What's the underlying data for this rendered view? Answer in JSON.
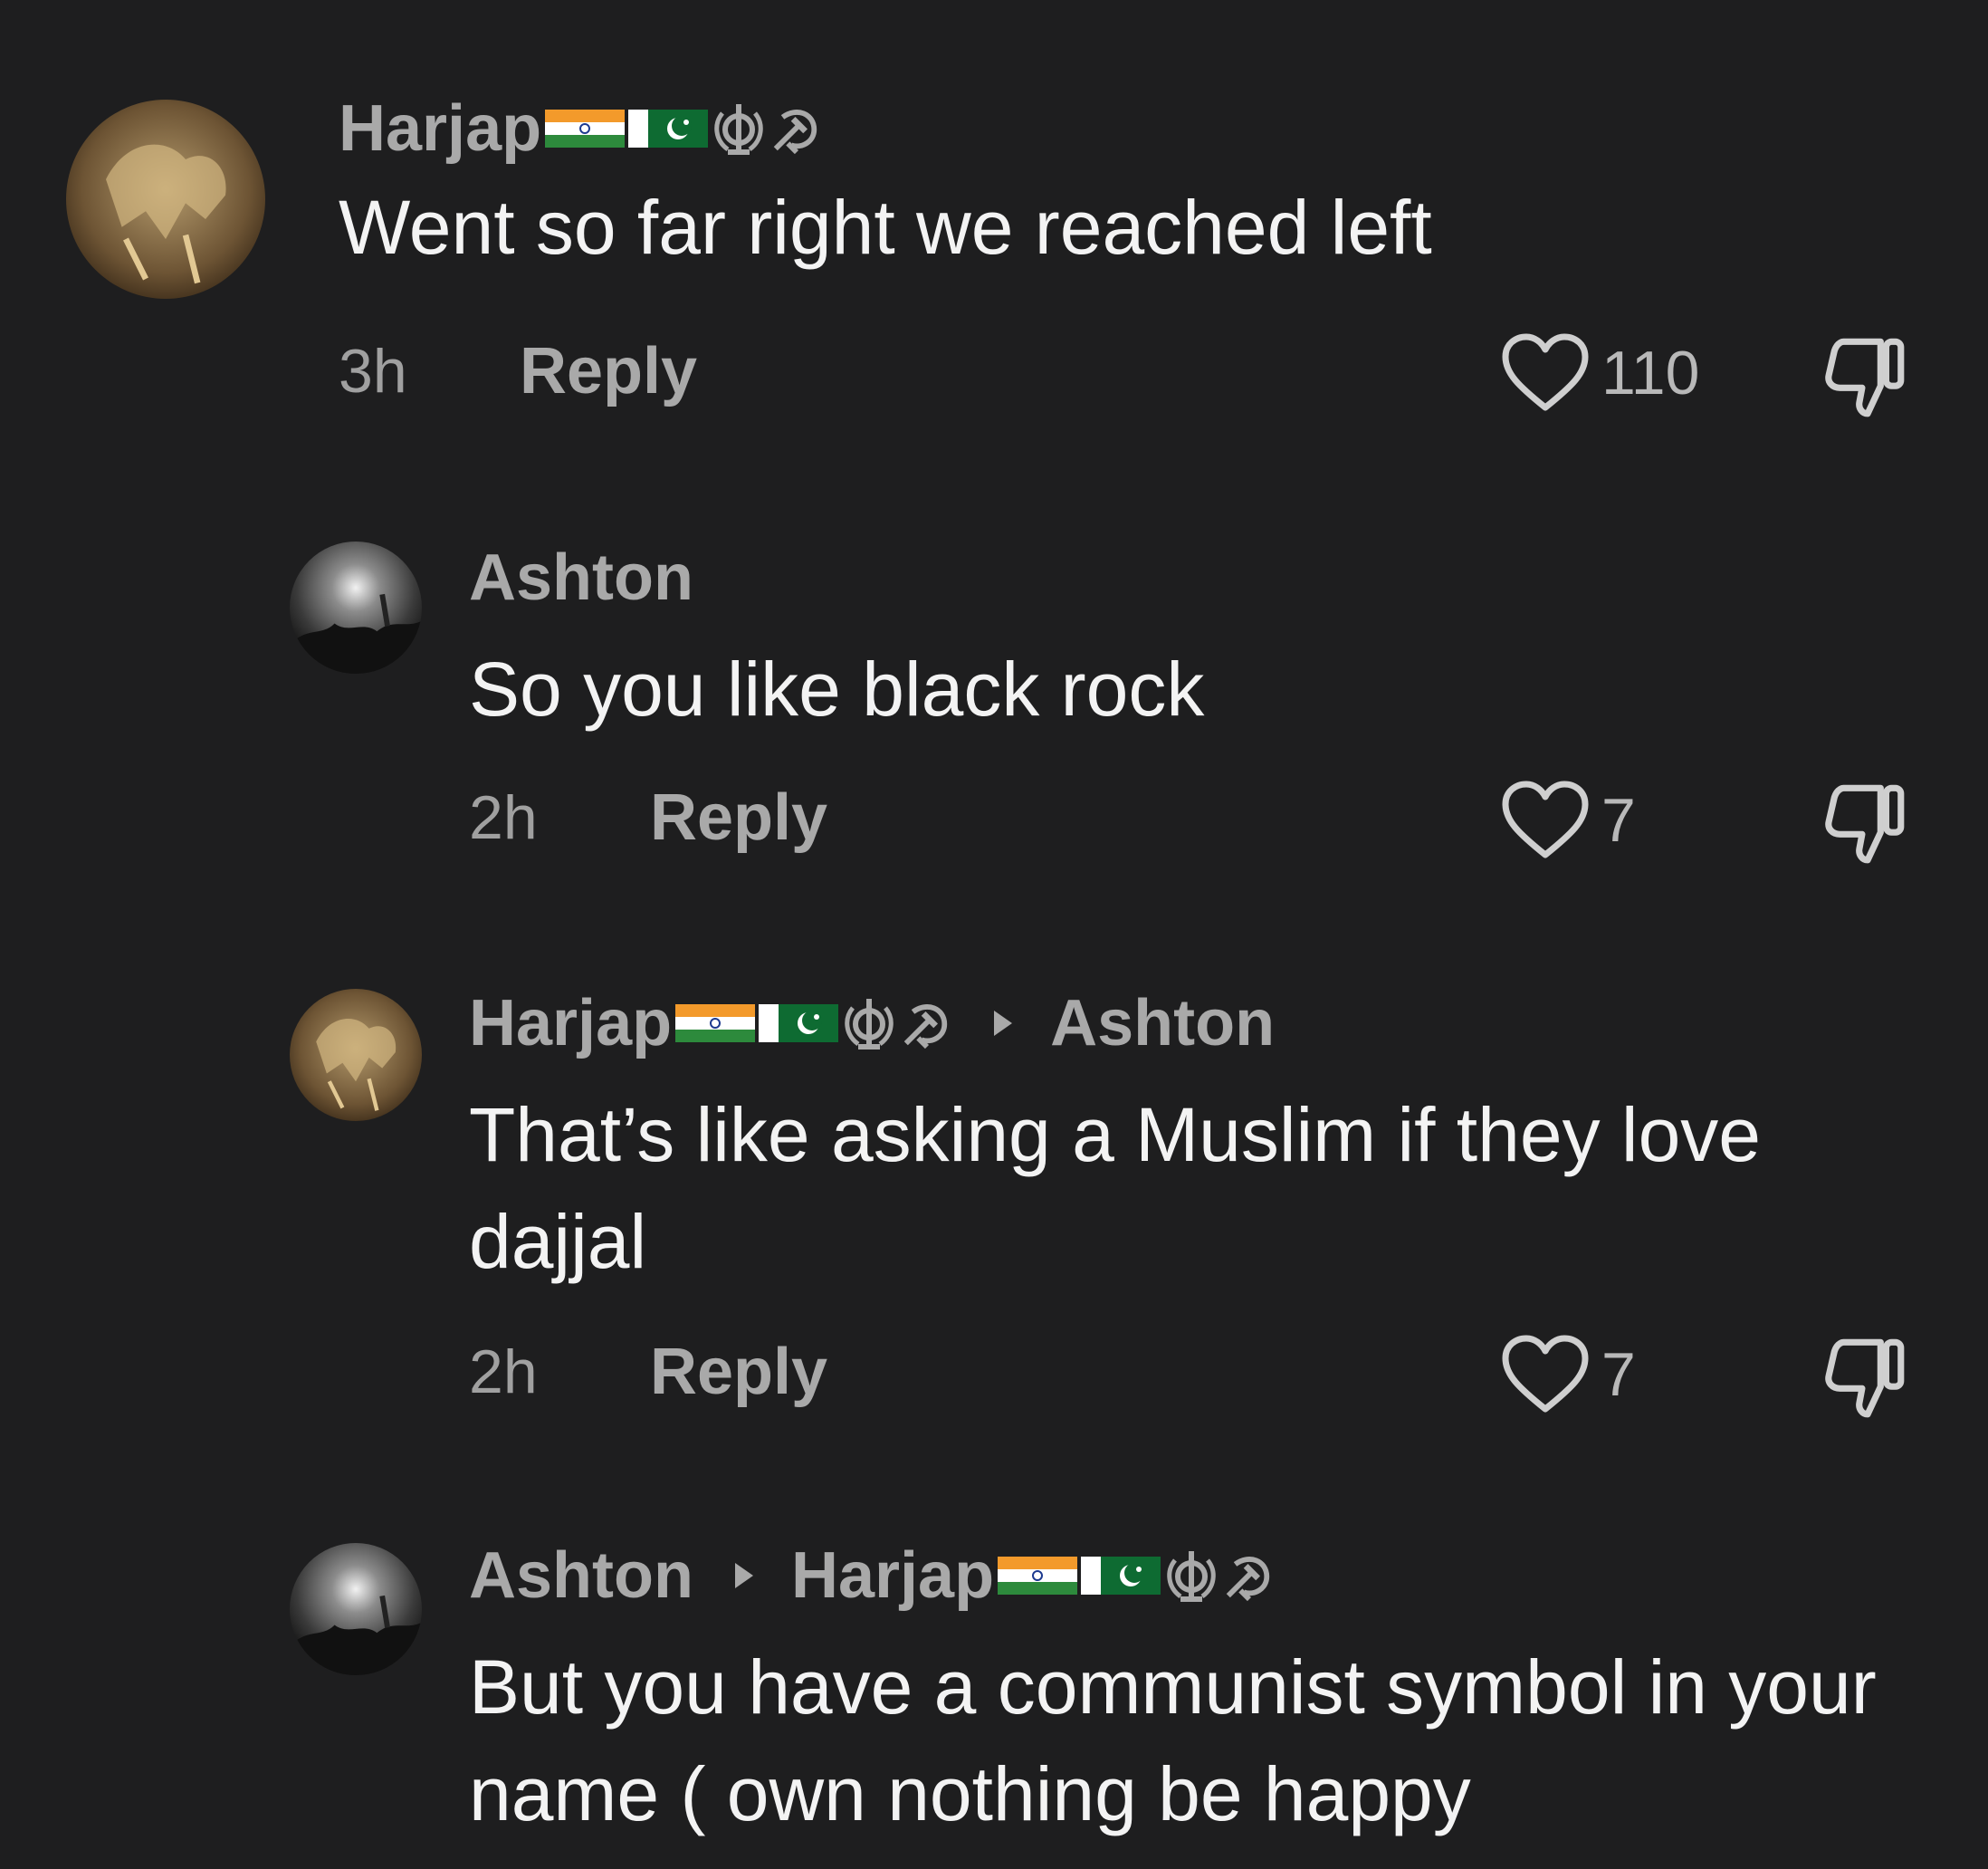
{
  "comments": [
    {
      "author": "Harjap",
      "text": "Went so far right we reached left",
      "time": "3h",
      "reply_label": "Reply",
      "likes": "110"
    },
    {
      "author": "Ashton",
      "text": "So you like black rock",
      "time": "2h",
      "reply_label": "Reply",
      "likes": "7"
    },
    {
      "author": "Harjap",
      "reply_to": "Ashton",
      "text": "That’s like asking a Muslim if they love dajjal",
      "time": "2h",
      "reply_label": "Reply",
      "likes": "7"
    },
    {
      "author": "Ashton",
      "reply_to": "Harjap",
      "text": "But you have a communist symbol in your name ( own nothing be happy"
    }
  ],
  "icons": {
    "badges": [
      "india-flag-icon",
      "pakistan-flag-icon",
      "khanda-icon",
      "hammer-sickle-icon"
    ],
    "like": "heart-outline-icon",
    "dislike": "thumbs-down-outline-icon"
  },
  "colors": {
    "background": "#1e1e1f",
    "username": "#a9a9a9",
    "comment_text": "#f3f3f3",
    "meta": "#a0a0a0"
  }
}
